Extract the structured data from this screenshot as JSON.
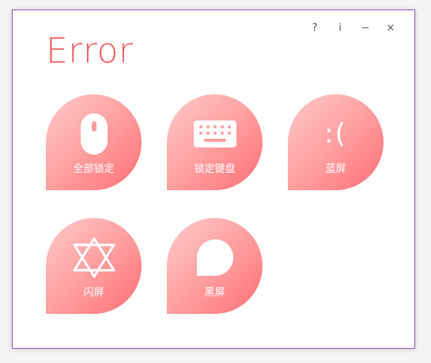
{
  "window": {
    "controls": {
      "help": "?",
      "info": "i",
      "minimize": "−",
      "close": "×"
    },
    "title": "Error"
  },
  "tiles": [
    {
      "label": "全部锁定",
      "icon": "mouse-icon"
    },
    {
      "label": "锁定键盘",
      "icon": "keyboard-icon"
    },
    {
      "label": "蓝屏",
      "icon": "sad-face-icon",
      "glyph": ":("
    },
    {
      "label": "闪屏",
      "icon": "hexagram-icon"
    },
    {
      "label": "黑屏",
      "icon": "speech-bubble-icon"
    }
  ],
  "colors": {
    "accent": "#ef5f61",
    "tile_gradient_start": "#ffcaca",
    "tile_gradient_end": "#ff6f74",
    "border": "#8a5cc0"
  }
}
